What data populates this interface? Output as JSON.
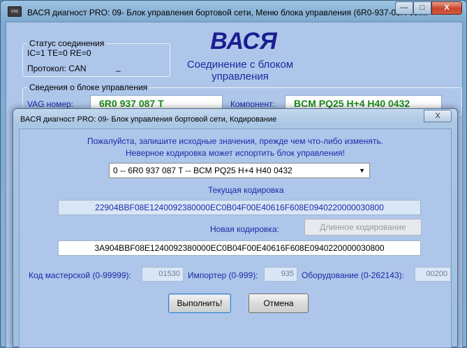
{
  "main_window": {
    "icon_text": "VAG",
    "title": "ВАСЯ диагност PRO: 09- Блок управления бортовой сети,  Меню блока управления (6R0-937-08X-09....",
    "minimize_glyph": "—",
    "maximize_glyph": "□",
    "close_glyph": "X",
    "status_group": {
      "label": "Статус соединения",
      "line1": "IC=1  TE=0  RE=0",
      "protocol": "Протокол: CAN",
      "protocol_value": "_"
    },
    "logo": "ВАСЯ",
    "connection_text": "Соединение с блоком управления",
    "info_group": {
      "label": "Сведения о блоке управления",
      "vag_label": "VAG номер:",
      "vag_value": "6R0 937 087 T",
      "component_label": "Компонент:",
      "component_value": "BCM PQ25 H+4   H40 0432"
    }
  },
  "dialog": {
    "title": "ВАСЯ диагност PRO: 09- Блок управления бортовой сети,  Кодирование",
    "close_glyph": "X",
    "warning_line1": "Пожалуйста, запишите исходные значения, прежде чем что-либо изменять.",
    "warning_line2": "Неверное кодировка может испортить блок управления!",
    "module_select": "0 -- 6R0 937 087 T -- BCM PQ25 H+4   H40 0432",
    "select_arrow": "▼",
    "current_coding_label": "Текущая кодировка",
    "current_coding": "22904BBF08E1240092380000EC0B04F00E40616F608E0940220000030800",
    "new_coding_label": "Новая кодировка:",
    "long_coding_button": "Длинное кодирование",
    "new_coding": "3A904BBF08E1240092380000EC0B04F00E40616F608E0940220000030800",
    "workshop_label": "Код мастерской (0-99999):",
    "workshop_value": "01530",
    "importer_label": "Импортер (0-999):",
    "importer_value": "935",
    "equipment_label": "Оборудование (0-262143):",
    "equipment_value": "00200",
    "execute_button": "Выполнить!",
    "cancel_button": "Отмена"
  }
}
